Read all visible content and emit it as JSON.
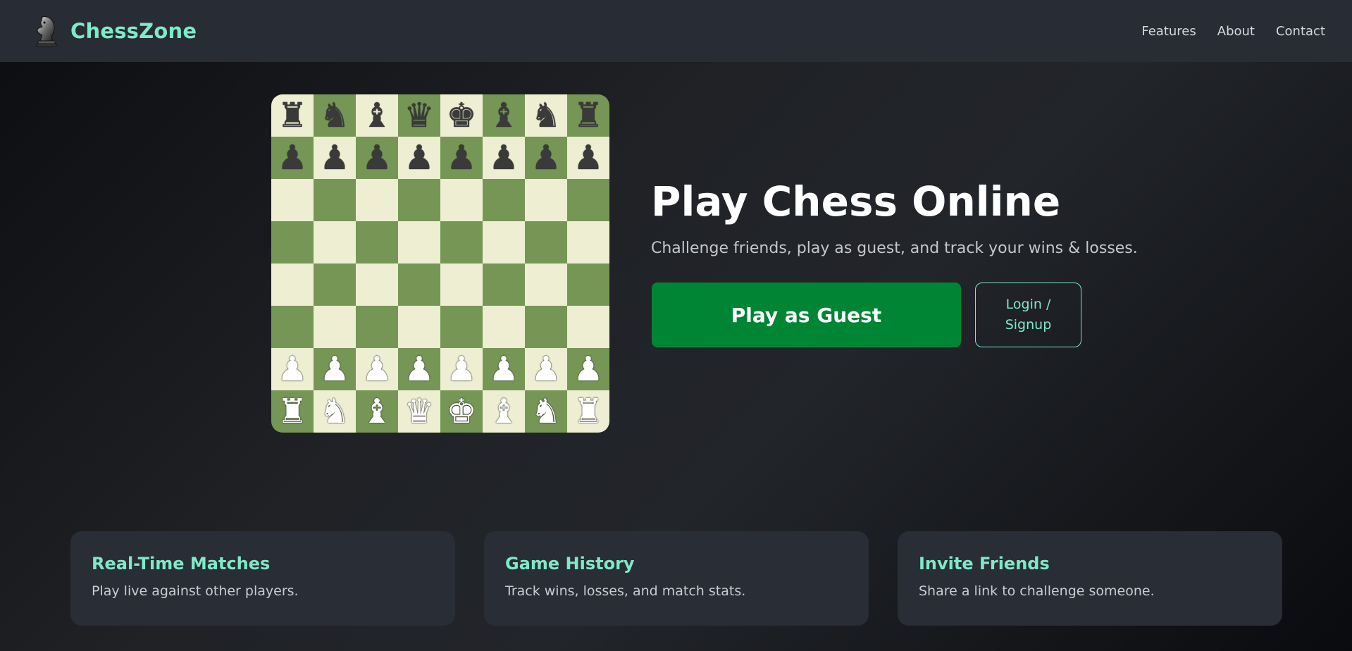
{
  "header": {
    "brand": "ChessZone",
    "logo_icon": "chess-knight-icon",
    "nav": [
      {
        "label": "Features"
      },
      {
        "label": "About"
      },
      {
        "label": "Contact"
      }
    ]
  },
  "board": {
    "light_color": "#eeeed2",
    "dark_color": "#769656",
    "ranks": [
      [
        "♜",
        "♞",
        "♝",
        "♛",
        "♚",
        "♝",
        "♞",
        "♜"
      ],
      [
        "♟",
        "♟",
        "♟",
        "♟",
        "♟",
        "♟",
        "♟",
        "♟"
      ],
      [
        "",
        "",
        "",
        "",
        "",
        "",
        "",
        ""
      ],
      [
        "",
        "",
        "",
        "",
        "",
        "",
        "",
        ""
      ],
      [
        "",
        "",
        "",
        "",
        "",
        "",
        "",
        ""
      ],
      [
        "",
        "",
        "",
        "",
        "",
        "",
        "",
        ""
      ],
      [
        "♙",
        "♙",
        "♙",
        "♙",
        "♙",
        "♙",
        "♙",
        "♙"
      ],
      [
        "♖",
        "♘",
        "♗",
        "♕",
        "♔",
        "♗",
        "♘",
        "♖"
      ]
    ]
  },
  "hero": {
    "title": "Play Chess Online",
    "subtitle": "Challenge friends, play as guest, and track your wins & losses.",
    "guest_button": "Play as Guest",
    "login_button": "Login / Signup"
  },
  "features": [
    {
      "title": "Real-Time Matches",
      "desc": "Play live against other players."
    },
    {
      "title": "Game History",
      "desc": "Track wins, losses, and match stats."
    },
    {
      "title": "Invite Friends",
      "desc": "Share a link to challenge someone."
    }
  ],
  "colors": {
    "accent": "#7fe9c8",
    "primary_button": "#008535",
    "header_bg": "#282c34",
    "card_bg": "#292d35"
  }
}
